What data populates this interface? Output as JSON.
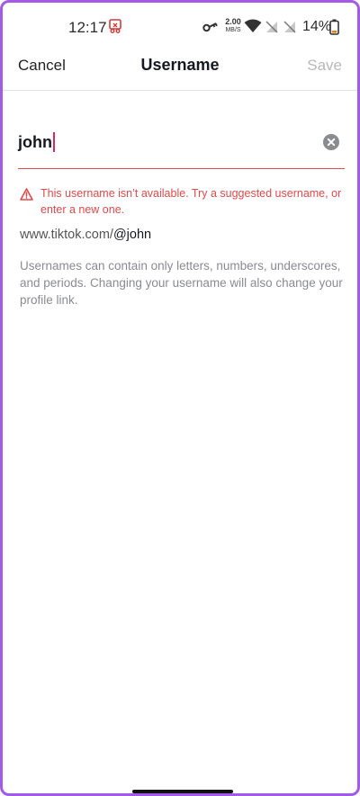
{
  "status_bar": {
    "time": "12:17",
    "speed_value": "2.00",
    "speed_unit": "MB/S",
    "battery": "14%"
  },
  "header": {
    "cancel_label": "Cancel",
    "title": "Username",
    "save_label": "Save"
  },
  "username_field": {
    "value": "john"
  },
  "error": {
    "message": "This username isn’t available. Try a suggested username, or enter a new one."
  },
  "profile_link": {
    "prefix": "www.tiktok.com/",
    "handle": "@john"
  },
  "help_text": "Usernames can contain only letters, numbers, underscores, and periods. Changing your username will also change your profile link.",
  "colors": {
    "error": "#e04a4a",
    "caret": "#e0245e",
    "disabled_save": "#b8b8b8",
    "frame_border": "#a35ae6"
  },
  "icons": [
    "screen-record-icon",
    "key-icon",
    "wifi-icon",
    "sim-off-icon",
    "battery-icon",
    "clear-icon",
    "warning-icon"
  ]
}
